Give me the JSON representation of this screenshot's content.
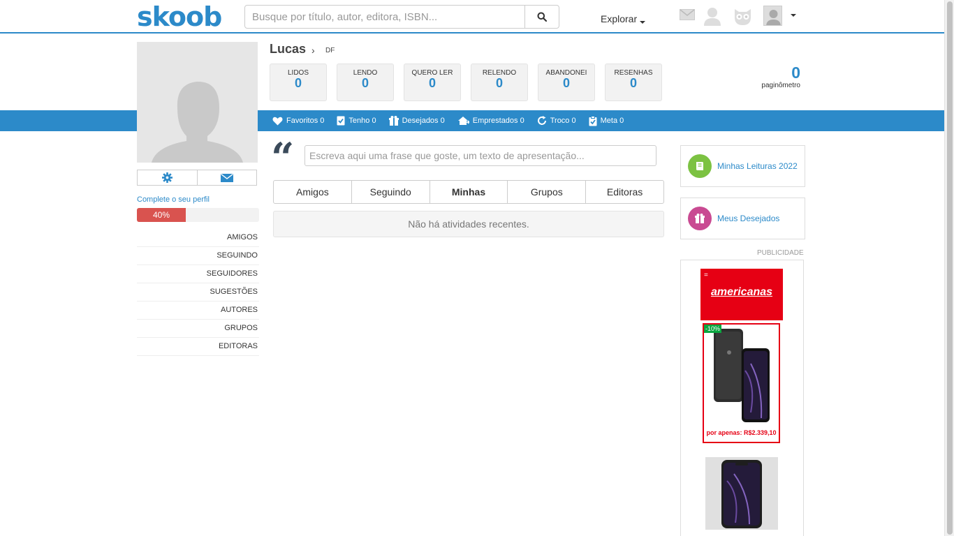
{
  "header": {
    "logo": "skoob",
    "search_placeholder": "Busque por título, autor, editora, ISBN...",
    "explorar": "Explorar"
  },
  "profile": {
    "name": "Lucas",
    "state": "DF",
    "complete_link": "Complete o seu perfil",
    "progress_label": "40%",
    "progress_value": 40
  },
  "stats": [
    {
      "label": "LIDOS",
      "value": "0"
    },
    {
      "label": "LENDO",
      "value": "0"
    },
    {
      "label": "QUERO LER",
      "value": "0"
    },
    {
      "label": "RELENDO",
      "value": "0"
    },
    {
      "label": "ABANDONEI",
      "value": "0"
    },
    {
      "label": "RESENHAS",
      "value": "0"
    }
  ],
  "paginometro": {
    "value": "0",
    "label": "paginômetro"
  },
  "bluebar": [
    {
      "label": "Favoritos 0",
      "icon": "heart-icon"
    },
    {
      "label": "Tenho 0",
      "icon": "book-check-icon"
    },
    {
      "label": "Desejados 0",
      "icon": "gift-icon"
    },
    {
      "label": "Emprestados 0",
      "icon": "house-arrow-icon"
    },
    {
      "label": "Troco 0",
      "icon": "refresh-icon"
    },
    {
      "label": "Meta 0",
      "icon": "clipboard-check-icon"
    }
  ],
  "side_nav": [
    "AMIGOS",
    "SEGUINDO",
    "SEGUIDORES",
    "SUGESTÕES",
    "AUTORES",
    "GRUPOS",
    "EDITORAS"
  ],
  "phrase_placeholder": "Escreva aqui uma frase que goste, um texto de apresentação...",
  "tabs": [
    "Amigos",
    "Seguindo",
    "Minhas",
    "Grupos",
    "Editoras"
  ],
  "active_tab": "Minhas",
  "empty_message": "Não há atividades recentes.",
  "right_cards": [
    {
      "label": "Minhas Leituras 2022",
      "color": "#7cc242",
      "icon": "book-icon"
    },
    {
      "label": "Meus Desejados",
      "color": "#c94a92",
      "icon": "gift-icon"
    }
  ],
  "publicidade": "PUBLICIDADE",
  "ad": {
    "brand": "americanas",
    "menu": "=",
    "discount": "-10%",
    "price": "por apenas: R$2.339,10"
  },
  "colors": {
    "brand": "#2c8ac9",
    "progress": "#d9534f",
    "ad_red": "#e60014"
  }
}
